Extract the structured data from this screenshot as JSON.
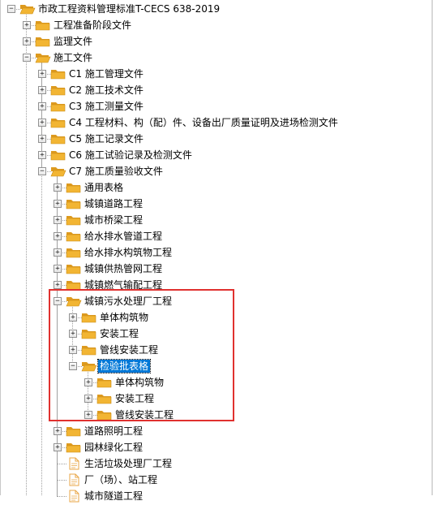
{
  "tree": [
    {
      "label": "市政工程资料管理标准T-CECS 638-2019",
      "depth": 0,
      "type": "folder",
      "expander": "minus"
    },
    {
      "label": "工程准备阶段文件",
      "depth": 1,
      "type": "folder",
      "expander": "plus"
    },
    {
      "label": "监理文件",
      "depth": 1,
      "type": "folder",
      "expander": "plus"
    },
    {
      "label": "施工文件",
      "depth": 1,
      "type": "folder",
      "expander": "minus"
    },
    {
      "label": "C1 施工管理文件",
      "depth": 2,
      "type": "folder",
      "expander": "plus"
    },
    {
      "label": "C2 施工技术文件",
      "depth": 2,
      "type": "folder",
      "expander": "plus"
    },
    {
      "label": "C3 施工测量文件",
      "depth": 2,
      "type": "folder",
      "expander": "plus"
    },
    {
      "label": "C4 工程材料、构（配）件、设备出厂质量证明及进场检测文件",
      "depth": 2,
      "type": "folder",
      "expander": "plus"
    },
    {
      "label": "C5 施工记录文件",
      "depth": 2,
      "type": "folder",
      "expander": "plus"
    },
    {
      "label": "C6 施工试验记录及检测文件",
      "depth": 2,
      "type": "folder",
      "expander": "plus"
    },
    {
      "label": "C7 施工质量验收文件",
      "depth": 2,
      "type": "folder",
      "expander": "minus"
    },
    {
      "label": "通用表格",
      "depth": 3,
      "type": "folder",
      "expander": "plus"
    },
    {
      "label": "城镇道路工程",
      "depth": 3,
      "type": "folder",
      "expander": "plus"
    },
    {
      "label": "城市桥梁工程",
      "depth": 3,
      "type": "folder",
      "expander": "plus"
    },
    {
      "label": "给水排水管道工程",
      "depth": 3,
      "type": "folder",
      "expander": "plus"
    },
    {
      "label": "给水排水构筑物工程",
      "depth": 3,
      "type": "folder",
      "expander": "plus"
    },
    {
      "label": "城镇供热管网工程",
      "depth": 3,
      "type": "folder",
      "expander": "plus"
    },
    {
      "label": "城镇燃气输配工程",
      "depth": 3,
      "type": "folder",
      "expander": "plus"
    },
    {
      "label": "城镇污水处理厂工程",
      "depth": 3,
      "type": "folder",
      "expander": "minus"
    },
    {
      "label": "单体构筑物",
      "depth": 4,
      "type": "folder",
      "expander": "plus"
    },
    {
      "label": "安装工程",
      "depth": 4,
      "type": "folder",
      "expander": "plus"
    },
    {
      "label": "管线安装工程",
      "depth": 4,
      "type": "folder",
      "expander": "plus"
    },
    {
      "label": "检验批表格",
      "depth": 4,
      "type": "folder",
      "expander": "minus",
      "selected": true
    },
    {
      "label": "单体构筑物",
      "depth": 5,
      "type": "folder",
      "expander": "plus"
    },
    {
      "label": "安装工程",
      "depth": 5,
      "type": "folder",
      "expander": "plus"
    },
    {
      "label": "管线安装工程",
      "depth": 5,
      "type": "folder",
      "expander": "plus"
    },
    {
      "label": "道路照明工程",
      "depth": 3,
      "type": "folder",
      "expander": "plus"
    },
    {
      "label": "园林绿化工程",
      "depth": 3,
      "type": "folder",
      "expander": "plus"
    },
    {
      "label": "生活垃圾处理厂工程",
      "depth": 3,
      "type": "document",
      "expander": "none"
    },
    {
      "label": "厂（场）、站工程",
      "depth": 3,
      "type": "document",
      "expander": "none"
    },
    {
      "label": "城市隧道工程",
      "depth": 3,
      "type": "document",
      "expander": "none"
    }
  ],
  "colors": {
    "folder_body": "#f2b533",
    "folder_back": "#dd9a1f",
    "selection": "#0078d7",
    "highlight_box": "#e0312f",
    "document_fold": "#e9a544"
  },
  "icons": {
    "folder": "folder-icon",
    "document": "document-icon",
    "expand": "plus-icon",
    "collapse": "minus-icon"
  }
}
